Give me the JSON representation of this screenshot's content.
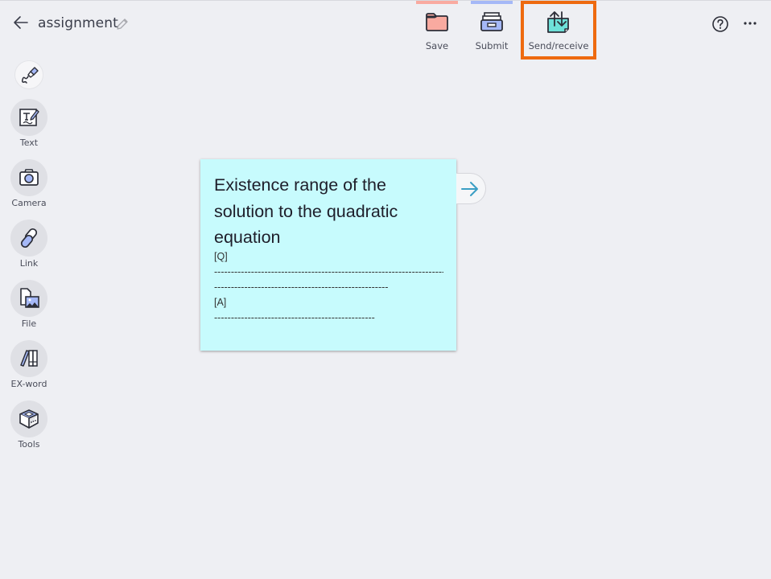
{
  "header": {
    "title": "assignment",
    "back_icon": "arrow-left-icon",
    "edit_icon": "pencil-icon",
    "actions": [
      {
        "id": "save",
        "label": "Save",
        "icon": "folder-icon",
        "accent": "#f9aaa0"
      },
      {
        "id": "submit",
        "label": "Submit",
        "icon": "inbox-tray-icon",
        "accent": "#a5b8f7"
      },
      {
        "id": "sendrecv",
        "label": "Send/receive",
        "icon": "send-receive-icon",
        "highlight": "#ee6a0f"
      }
    ],
    "help_icon": "question-circle-icon",
    "more_icon": "more-horizontal-icon"
  },
  "sidebar": {
    "items": [
      {
        "id": "pen",
        "label": "",
        "icon": "pen-icon"
      },
      {
        "id": "text",
        "label": "Text",
        "icon": "text-icon"
      },
      {
        "id": "camera",
        "label": "Camera",
        "icon": "camera-icon"
      },
      {
        "id": "link",
        "label": "Link",
        "icon": "link-icon"
      },
      {
        "id": "file",
        "label": "File",
        "icon": "file-image-icon"
      },
      {
        "id": "exword",
        "label": "EX-word",
        "icon": "books-icon"
      },
      {
        "id": "tools",
        "label": "Tools",
        "icon": "toolbox-icon"
      }
    ]
  },
  "card": {
    "title": "Existence range of the solution to the quadratic equation",
    "lines": [
      "[Q]",
      "----------------------------------------------------------------------",
      "----------------------------------------------------",
      "[A]",
      "------------------------------------------------"
    ],
    "background": "#c7fbfd",
    "connector_icon": "arrow-right-icon"
  }
}
